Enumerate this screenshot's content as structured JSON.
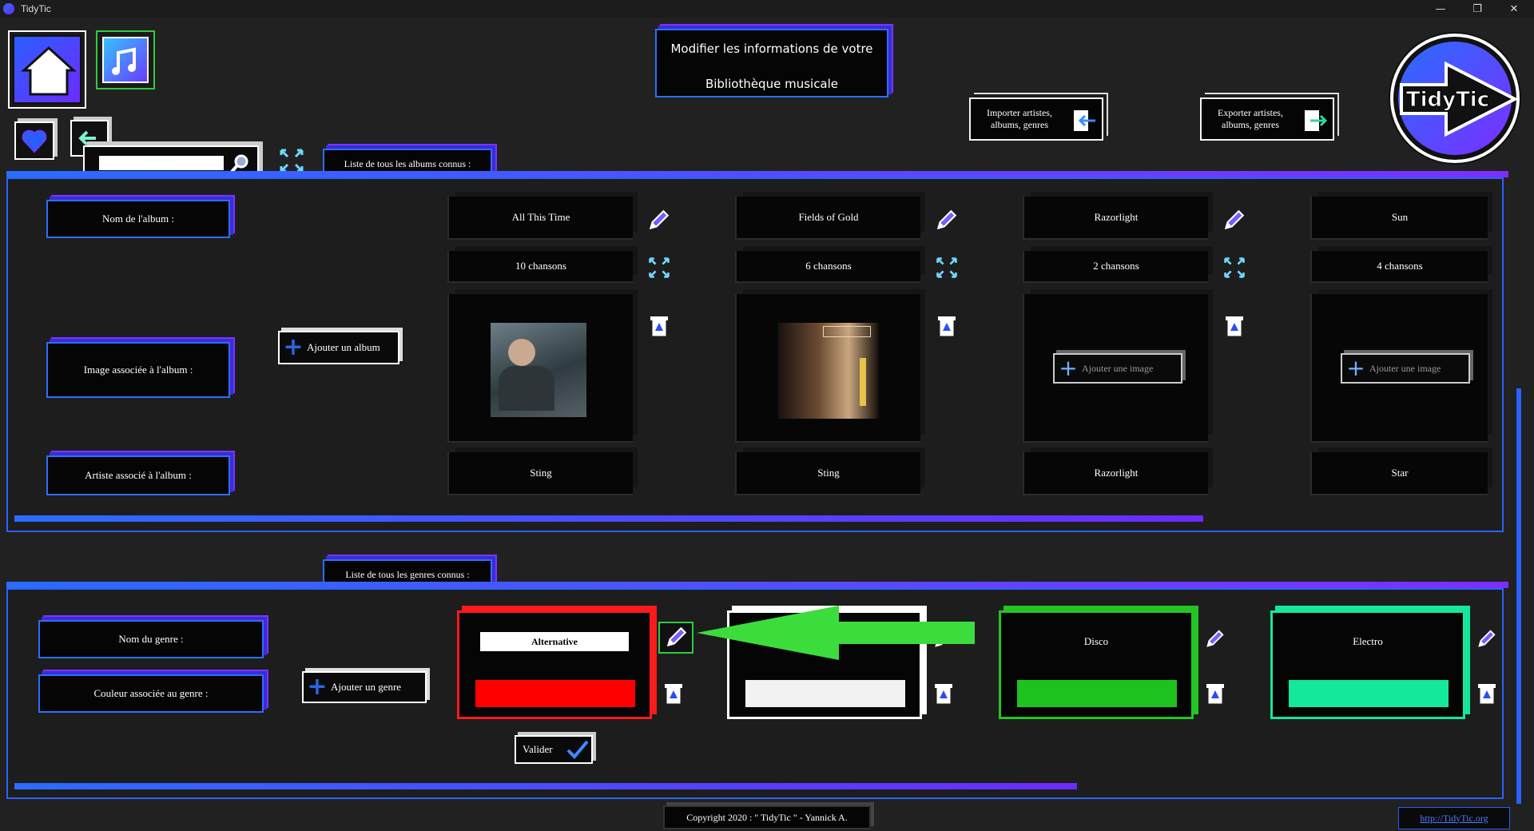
{
  "window": {
    "title": "TidyTic",
    "minimize": "—",
    "restore": "❐",
    "close": "✕"
  },
  "header": {
    "title_line1": "Modifier les informations de votre",
    "title_line2": "Bibliothèque musicale",
    "import_label": "Importer artistes, albums, genres",
    "export_label": "Exporter artistes, albums, genres",
    "logo_text": "TidyTic"
  },
  "search": {
    "value": "",
    "placeholder": ""
  },
  "albums": {
    "tab_label": "Liste de tous les albums connus :",
    "row_labels": {
      "name": "Nom de l'album :",
      "image": "Image associée à l'album :",
      "artist": "Artiste associé à l'album :"
    },
    "add_label": "Ajouter un album",
    "add_image_label": "Ajouter une image",
    "items": [
      {
        "name": "All This Time",
        "songs": "10 chansons",
        "artist": "Sting",
        "has_image": true
      },
      {
        "name": "Fields of Gold",
        "songs": "6 chansons",
        "artist": "Sting",
        "has_image": true
      },
      {
        "name": "Razorlight",
        "songs": "2 chansons",
        "artist": "Razorlight",
        "has_image": false
      },
      {
        "name": "Sun",
        "songs": "4 chansons",
        "artist": "Star",
        "has_image": false
      }
    ],
    "scroll_fraction": 0.8
  },
  "genres": {
    "tab_label": "Liste de tous les genres connus :",
    "row_labels": {
      "name": "Nom du genre :",
      "color": "Couleur associée au genre :"
    },
    "add_label": "Ajouter un genre",
    "validate_label": "Valider",
    "items": [
      {
        "name": "Alternative",
        "color": "#ff0000",
        "editing": true
      },
      {
        "name": "",
        "color": "#f2f2f2",
        "editing": false
      },
      {
        "name": "Disco",
        "color": "#1ec21e",
        "editing": false
      },
      {
        "name": "Electro",
        "color": "#14e89a",
        "editing": false
      }
    ],
    "scroll_fraction": 0.72
  },
  "footer": {
    "copyright": "Copyright 2020 : \" TidyTic \" - Yannick A.",
    "link": "http://TidyTic.org"
  },
  "colors": {
    "accent_blue": "#2a6cff",
    "accent_purple": "#7b2fff",
    "arrow_green": "#3ddc3d"
  }
}
